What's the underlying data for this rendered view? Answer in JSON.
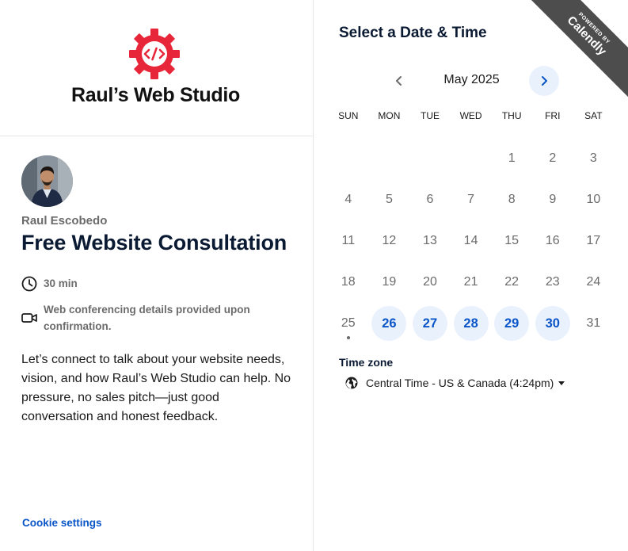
{
  "brand": {
    "name": "Raul’s Web Studio",
    "logo_icon": "gear-code-icon",
    "accent": "#e8263a"
  },
  "event": {
    "host": "Raul Escobedo",
    "title": "Free Website Consultation",
    "duration": "30 min",
    "location": "Web conferencing details provided upon confirmation.",
    "description": "Let’s connect to talk about your website needs, vision, and how Raul’s Web Studio can help. No pressure, no sales pitch—just good conversation and honest feedback."
  },
  "footer": {
    "cookie_settings": "Cookie settings"
  },
  "ribbon": {
    "powered_by": "POWERED BY",
    "brand": "Calendly"
  },
  "calendar": {
    "title": "Select a Date & Time",
    "month": "May 2025",
    "weekdays": [
      "SUN",
      "MON",
      "TUE",
      "WED",
      "THU",
      "FRI",
      "SAT"
    ],
    "weeks": [
      [
        {
          "d": ""
        },
        {
          "d": ""
        },
        {
          "d": ""
        },
        {
          "d": ""
        },
        {
          "d": "1"
        },
        {
          "d": "2"
        },
        {
          "d": "3"
        }
      ],
      [
        {
          "d": "4"
        },
        {
          "d": "5"
        },
        {
          "d": "6"
        },
        {
          "d": "7"
        },
        {
          "d": "8"
        },
        {
          "d": "9"
        },
        {
          "d": "10"
        }
      ],
      [
        {
          "d": "11"
        },
        {
          "d": "12"
        },
        {
          "d": "13"
        },
        {
          "d": "14"
        },
        {
          "d": "15"
        },
        {
          "d": "16"
        },
        {
          "d": "17"
        }
      ],
      [
        {
          "d": "18"
        },
        {
          "d": "19"
        },
        {
          "d": "20"
        },
        {
          "d": "21"
        },
        {
          "d": "22"
        },
        {
          "d": "23"
        },
        {
          "d": "24"
        }
      ],
      [
        {
          "d": "25",
          "today": true
        },
        {
          "d": "26",
          "available": true
        },
        {
          "d": "27",
          "available": true
        },
        {
          "d": "28",
          "available": true
        },
        {
          "d": "29",
          "available": true
        },
        {
          "d": "30",
          "available": true
        },
        {
          "d": "31"
        }
      ]
    ],
    "accent": "#0a55c8",
    "available_bg": "#e9f1fd"
  },
  "timezone": {
    "label": "Time zone",
    "value": "Central Time - US & Canada (4:24pm)",
    "icon": "globe-icon"
  }
}
